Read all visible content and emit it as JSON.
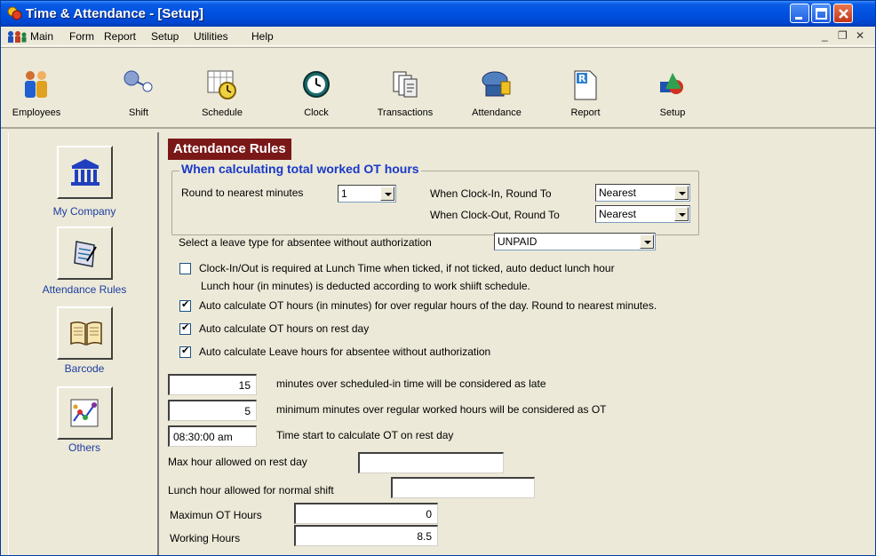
{
  "window": {
    "title": "Time & Attendance - [Setup]"
  },
  "menu": {
    "items": [
      "Main",
      "Form",
      "Report",
      "Setup",
      "Utilities",
      "Help"
    ]
  },
  "toolbar": {
    "items": [
      "Employees",
      "Shift",
      "Schedule",
      "Clock",
      "Transactions",
      "Attendance",
      "Report",
      "Setup"
    ]
  },
  "sidebar": {
    "items": [
      "My Company",
      "Attendance Rules",
      "Barcode",
      "Others"
    ]
  },
  "main": {
    "header": "Attendance Rules",
    "ot_group": {
      "title": "When calculating total worked OT hours",
      "round_label": "Round to nearest minutes",
      "round_value": "1",
      "clock_in_label": "When Clock-In, Round To",
      "clock_in_value": "Nearest",
      "clock_out_label": "When Clock-Out, Round To",
      "clock_out_value": "Nearest"
    },
    "leave_type_label": "Select a leave type for absentee without authorization",
    "leave_type_value": "UNPAID",
    "checkboxes": [
      {
        "label": "Clock-In/Out is required at Lunch Time when ticked, if not ticked, auto deduct lunch hour",
        "sub": "Lunch hour (in minutes) is deducted according to work shiift schedule.",
        "checked": false
      },
      {
        "label": "Auto calculate OT hours (in minutes) for over regular hours of the day. Round to nearest minutes.",
        "checked": true
      },
      {
        "label": "Auto calculate OT hours on rest day",
        "checked": true
      },
      {
        "label": "Auto calculate Leave hours for absentee without authorization",
        "checked": true
      }
    ],
    "late_minutes": "15",
    "late_label": "minutes over scheduled-in time will be considered as late",
    "ot_min_minutes": "5",
    "ot_min_label": "minimum minutes over regular worked hours will be considered as OT",
    "ot_start_time": "08:30:00 am",
    "ot_start_label": "Time start to calculate OT on rest day",
    "max_rest_label": "Max hour allowed on rest day",
    "max_rest_value": "",
    "lunch_label": "Lunch hour allowed for normal shift",
    "lunch_value": "",
    "max_ot_label": "Maximun OT Hours",
    "max_ot_value": "0",
    "working_hours_label": "Working Hours",
    "working_hours_value": "8.5"
  }
}
